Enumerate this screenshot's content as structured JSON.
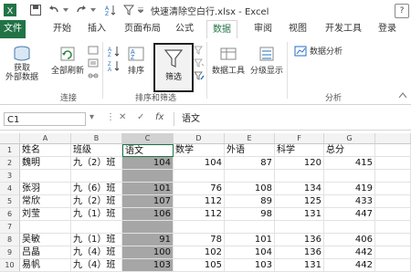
{
  "window": {
    "title": "快速清除空白行.xlsx - Excel",
    "help": "?"
  },
  "tabs": [
    "文件",
    "开始",
    "插入",
    "页面布局",
    "公式",
    "数据",
    "审阅",
    "视图",
    "开发工具",
    "登录"
  ],
  "active_tab": "数据",
  "ribbon": {
    "get_external": "获取\n外部数据",
    "refresh_all": "全部刷新",
    "connections_group": "连接",
    "sort_az": "A↓Z",
    "sort_label": "排序",
    "filter_label": "筛选",
    "sort_filter_group": "排序和筛选",
    "data_tools": "数据工具",
    "outline": "分级显示",
    "data_analysis": "数据分析",
    "analysis_group": "分析"
  },
  "formula_bar": {
    "name_box": "C1",
    "fx": "fx",
    "content": "语文"
  },
  "columns": [
    "A",
    "B",
    "C",
    "D",
    "E",
    "F",
    "G"
  ],
  "rows": [
    {
      "n": "1",
      "cells": [
        "姓名",
        "班级",
        "语文",
        "数学",
        "外语",
        "科学",
        "总分"
      ]
    },
    {
      "n": "2",
      "cells": [
        "魏明",
        "九（2）班",
        "104",
        "104",
        "87",
        "120",
        "415"
      ]
    },
    {
      "n": "3",
      "cells": [
        "",
        "",
        "",
        "",
        "",
        "",
        ""
      ]
    },
    {
      "n": "4",
      "cells": [
        "张羽",
        "九（6）班",
        "101",
        "76",
        "108",
        "134",
        "419"
      ]
    },
    {
      "n": "5",
      "cells": [
        "常欣",
        "九（2）班",
        "107",
        "112",
        "89",
        "125",
        "433"
      ]
    },
    {
      "n": "6",
      "cells": [
        "刘莹",
        "九（1）班",
        "106",
        "112",
        "98",
        "131",
        "447"
      ]
    },
    {
      "n": "7",
      "cells": [
        "",
        "",
        "",
        "",
        "",
        "",
        ""
      ]
    },
    {
      "n": "8",
      "cells": [
        "吴敏",
        "九（1）班",
        "91",
        "78",
        "101",
        "136",
        "406"
      ]
    },
    {
      "n": "9",
      "cells": [
        "吕晶",
        "九（4）班",
        "100",
        "102",
        "104",
        "136",
        "442"
      ]
    },
    {
      "n": "10",
      "cells": [
        "易帆",
        "九（4）班",
        "103",
        "105",
        "103",
        "131",
        "442"
      ]
    }
  ]
}
